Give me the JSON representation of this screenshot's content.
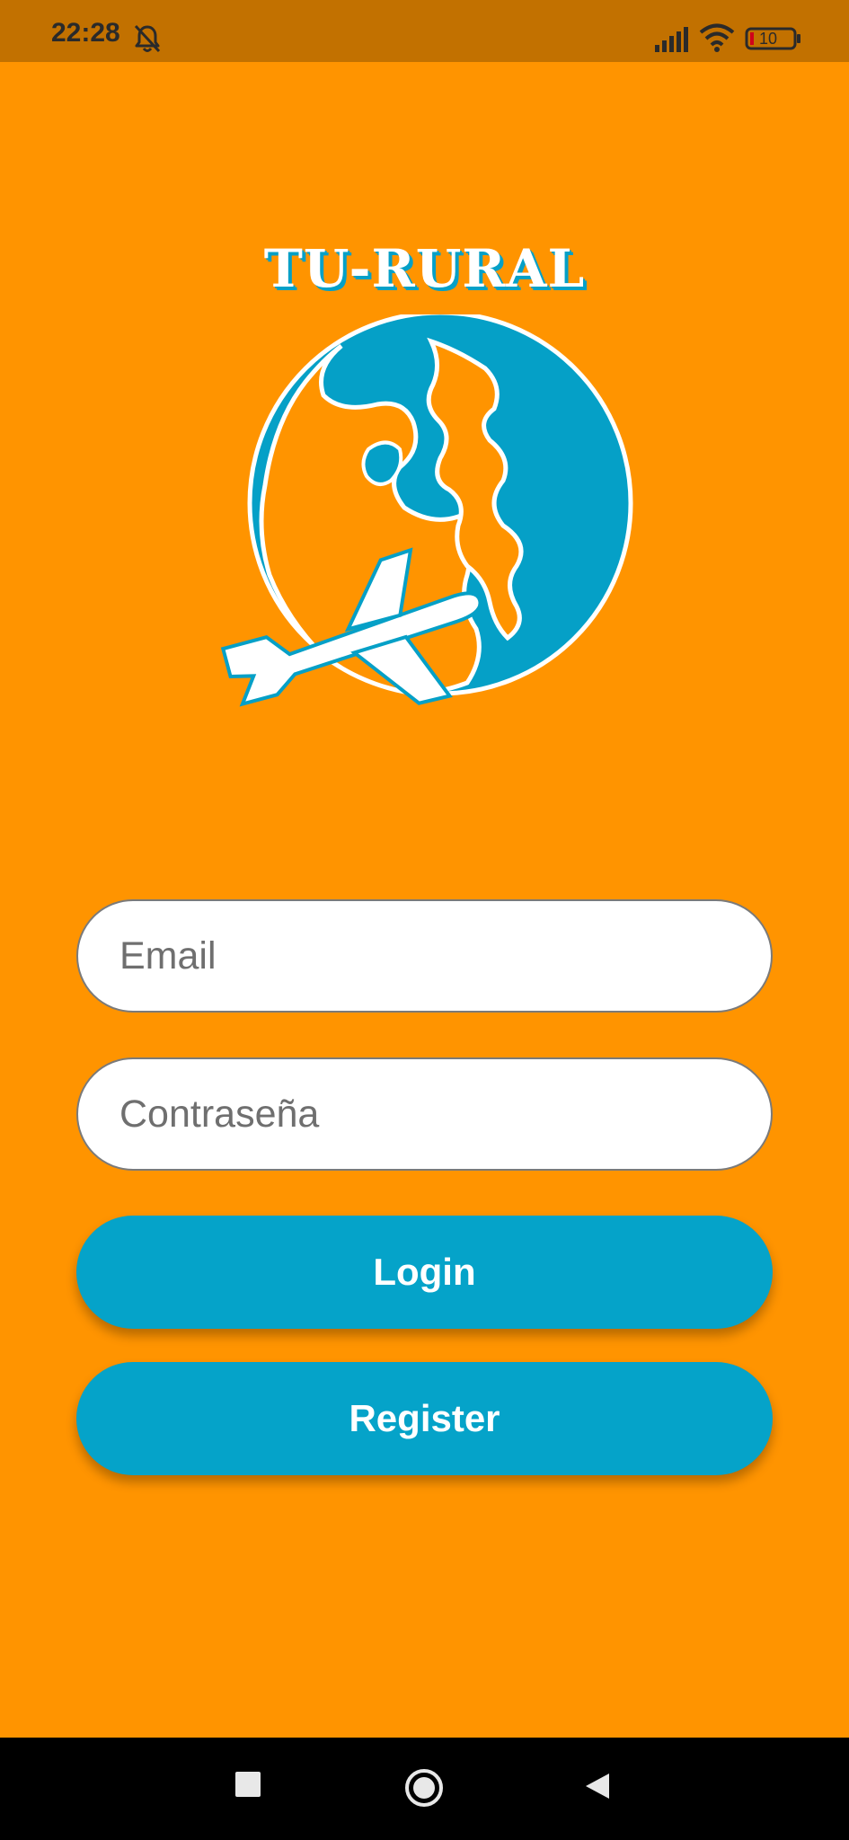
{
  "status_bar": {
    "time": "22:28",
    "battery_level": "10",
    "icons": [
      "bell-off-icon",
      "signal-icon",
      "wifi-icon",
      "battery-icon"
    ]
  },
  "app": {
    "title": "TU-RURAL",
    "logo_icon": "globe-airplane-icon"
  },
  "form": {
    "email_placeholder": "Email",
    "email_value": "",
    "password_placeholder": "Contraseña",
    "password_value": "",
    "login_label": "Login",
    "register_label": "Register"
  },
  "nav_bar": {
    "icons": [
      "recents-icon",
      "home-icon",
      "back-icon"
    ]
  },
  "colors": {
    "background": "#FF9400",
    "status_bar": "#C27100",
    "accent": "#05A3C9",
    "nav_bar": "#000000"
  }
}
